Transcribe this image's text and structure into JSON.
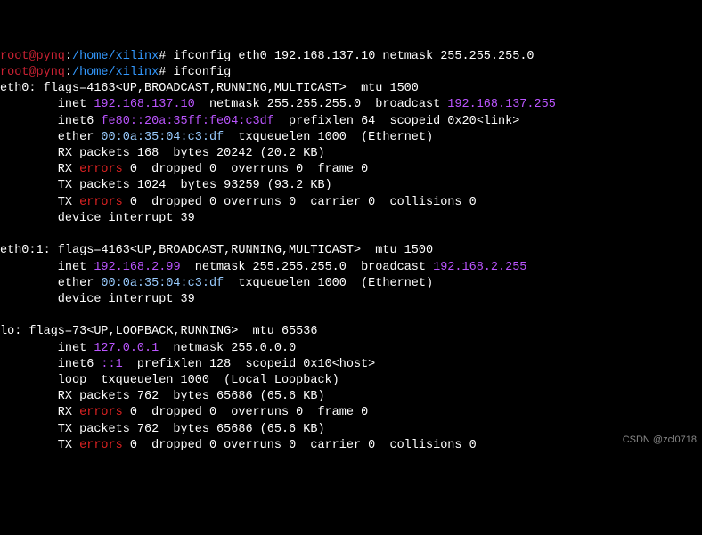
{
  "prompt1": {
    "user": "root@pynq",
    "colon": ":",
    "path": "/home/xilinx",
    "hash": "# ",
    "cmd": "ifconfig eth0 192.168.137.10 netmask 255.255.255.0"
  },
  "prompt2": {
    "user": "root@pynq",
    "colon": ":",
    "path": "/home/xilinx",
    "hash": "# ",
    "cmd": "ifconfig"
  },
  "eth0": {
    "name": "eth0",
    "flags": ": flags=4163<UP,BROADCAST,RUNNING,MULTICAST>  mtu 1500",
    "inet_lbl": "        inet ",
    "inet": "192.168.137.10",
    "netmask": "  netmask 255.255.255.0  broadcast ",
    "bcast": "192.168.137.255",
    "inet6_lbl": "        inet6 ",
    "inet6": "fe80::20a:35ff:fe04:c3df",
    "inet6_sfx": "  prefixlen 64  scopeid 0x20<link>",
    "ether_lbl": "        ether ",
    "mac": "00:0a:35:04:c3:df",
    "ether_sfx": "  txqueuelen 1000  (Ethernet)",
    "rx_pkt": "        RX packets 168  bytes 20242 (20.2 KB)",
    "rx_err_pre": "        RX ",
    "errors": "errors",
    "rx_err_post": " 0  dropped 0  overruns 0  frame 0",
    "tx_pkt": "        TX packets 1024  bytes 93259 (93.2 KB)",
    "tx_err_pre": "        TX ",
    "tx_err_post": " 0  dropped 0 overruns 0  carrier 0  collisions 0",
    "dev_int": "        device interrupt 39  "
  },
  "eth01": {
    "name": "eth0:1",
    "flags": ": flags=4163<UP,BROADCAST,RUNNING,MULTICAST>  mtu 1500",
    "inet_lbl": "        inet ",
    "inet": "192.168.2.99",
    "netmask": "  netmask 255.255.255.0  broadcast ",
    "bcast": "192.168.2.255",
    "ether_lbl": "        ether ",
    "mac": "00:0a:35:04:c3:df",
    "ether_sfx": "  txqueuelen 1000  (Ethernet)",
    "dev_int": "        device interrupt 39  "
  },
  "lo": {
    "name": "lo",
    "flags": ": flags=73<UP,LOOPBACK,RUNNING>  mtu 65536",
    "inet_lbl": "        inet ",
    "inet": "127.0.0.1",
    "netmask": "  netmask 255.0.0.0",
    "inet6_lbl": "        inet6 ",
    "inet6": "::1",
    "inet6_sfx": "  prefixlen 128  scopeid 0x10<host>",
    "loop": "        loop  txqueuelen 1000  (Local Loopback)",
    "rx_pkt": "        RX packets 762  bytes 65686 (65.6 KB)",
    "rx_err_pre": "        RX ",
    "errors": "errors",
    "rx_err_post": " 0  dropped 0  overruns 0  frame 0",
    "tx_pkt": "        TX packets 762  bytes 65686 (65.6 KB)",
    "tx_err_pre": "        TX ",
    "tx_err_post": " 0  dropped 0 overruns 0  carrier 0  collisions 0"
  },
  "watermark": "CSDN @zcl0718"
}
